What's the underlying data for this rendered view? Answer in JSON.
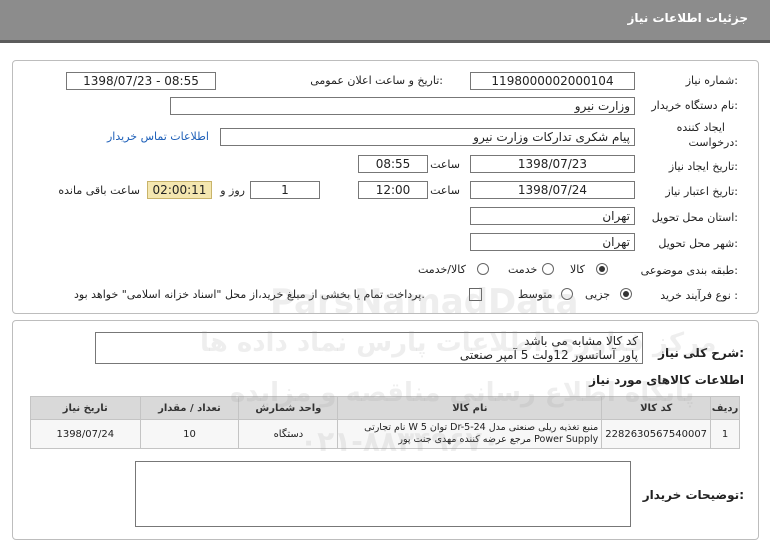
{
  "header": {
    "title": "جزئیات اطلاعات نیاز"
  },
  "info": {
    "need_number_label": "شماره نیاز:",
    "need_number": "1198000002000104",
    "announce_label": "تاریخ و ساعت اعلان عمومی:",
    "announce_value": "1398/07/23 - 08:55",
    "buyer_label": "نام دستگاه خریدار:",
    "buyer": "وزارت نیرو",
    "creator_label_1": "ایجاد کننده",
    "creator_label_2": "درخواست:",
    "creator": "پیام شکری تدارکات وزارت نیرو",
    "contact_link": "اطلاعات تماس خریدار",
    "created_label": "تاریخ ایجاد نیاز:",
    "created_date": "1398/07/23",
    "created_time_label": "ساعت",
    "created_time": "08:55",
    "validity_label": "تاریخ اعتبار نیاز:",
    "validity_date": "1398/07/24",
    "validity_time_label": "ساعت",
    "validity_time": "12:00",
    "days_value": "1",
    "days_label": "روز و",
    "remaining_time": "02:00:11",
    "remaining_label": "ساعت باقی مانده",
    "province_label": "استان محل تحویل:",
    "province": "تهران",
    "city_label": "شهر محل تحویل:",
    "city": "تهران",
    "category_label": "طبقه بندی موضوعی:",
    "category_options": [
      "کالا",
      "خدمت",
      "کالا/خدمت"
    ],
    "process_label": "نوع فرآیند خرید :",
    "process_options": [
      "جزیی",
      "متوسط"
    ],
    "payment_note": "پرداخت تمام یا بخشی از مبلغ خرید،از محل \"اسناد خزانه اسلامی\" خواهد بود."
  },
  "description": {
    "label": "شرح کلی نیاز:",
    "line1": "کد کالا  مشابه می باشد",
    "line2": "پاور آسانسور 12ولت 5 آمپر صنعتی"
  },
  "goods": {
    "section_title": "اطلاعات کالاهای مورد نیاز",
    "columns": [
      "ردیف",
      "کد کالا",
      "نام کالا",
      "واحد شمارش",
      "تعداد / مقدار",
      "تاریخ نیاز"
    ],
    "rows": [
      {
        "index": "1",
        "code": "2282630567540007",
        "name_line1": "منبع تغذیه ریلی صنعتی مدل Dr-5-24 توان W 5 نام تجارتی",
        "name_line2": "Power Supply مرجع عرضه کننده مهدی جنت پور",
        "unit": "دستگاه",
        "qty": "10",
        "date": "1398/07/24"
      }
    ]
  },
  "buyer_notes": {
    "label": "توضیحات خریدار:"
  },
  "watermark": {
    "line1": "ParsNamadData",
    "line2": "مرکز فناوری اطلاعات پارس نماد داده ها",
    "line3": "پایگاه اطلاع رسانی مناقصه و مزایده",
    "line4": "۰۲۱-۸۸۳۴۹۶۷۰"
  }
}
